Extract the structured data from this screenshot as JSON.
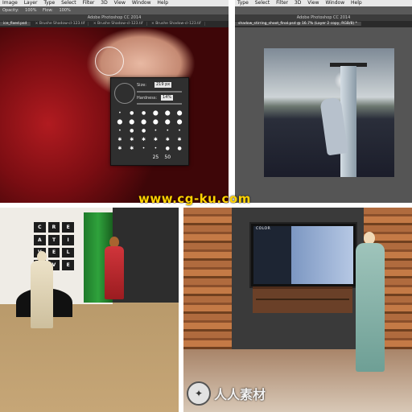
{
  "ps_left": {
    "menu": [
      "Image",
      "Layer",
      "Type",
      "Select",
      "Filter",
      "3D",
      "View",
      "Window",
      "Help"
    ],
    "options": {
      "opacity_label": "Opacity:",
      "opacity_value": "100%",
      "flow_label": "Flow:",
      "flow_value": "100%"
    },
    "app_title": "Adobe Photoshop CC 2014",
    "tabs": [
      "ice_fixed.psd",
      "× Brushe Shadow-cl-123.tif",
      "× Brushe Shadow-cl-123.tif",
      "× Brushe Shadow-cl-123.tif"
    ],
    "brush_panel": {
      "size_label": "Size:",
      "size_value": "219 px",
      "hardness_label": "Hardness:",
      "hardness_value": "14%",
      "tip_sizes": [
        "25",
        "50"
      ]
    }
  },
  "ps_right": {
    "menu": [
      "Type",
      "Select",
      "Filter",
      "3D",
      "View",
      "Window",
      "Help"
    ],
    "app_title": "Adobe Photoshop CC 2014",
    "tab": "shadow_stirring_shoot_final.psd @ 16.7% (Layer 2 copy, RGB/8) *"
  },
  "studio_sign": [
    "C",
    "R",
    "E",
    "A",
    "T",
    "I",
    "V",
    "E",
    "L",
    "I",
    "V",
    "E"
  ],
  "tv": {
    "word": "COLOR"
  },
  "watermark": "www.cg-ku.com",
  "logo_text": "人人素材",
  "colors": {
    "dress_red": "#b11b20",
    "green_screen": "#2fa23c",
    "watermark": "#ffd200"
  }
}
